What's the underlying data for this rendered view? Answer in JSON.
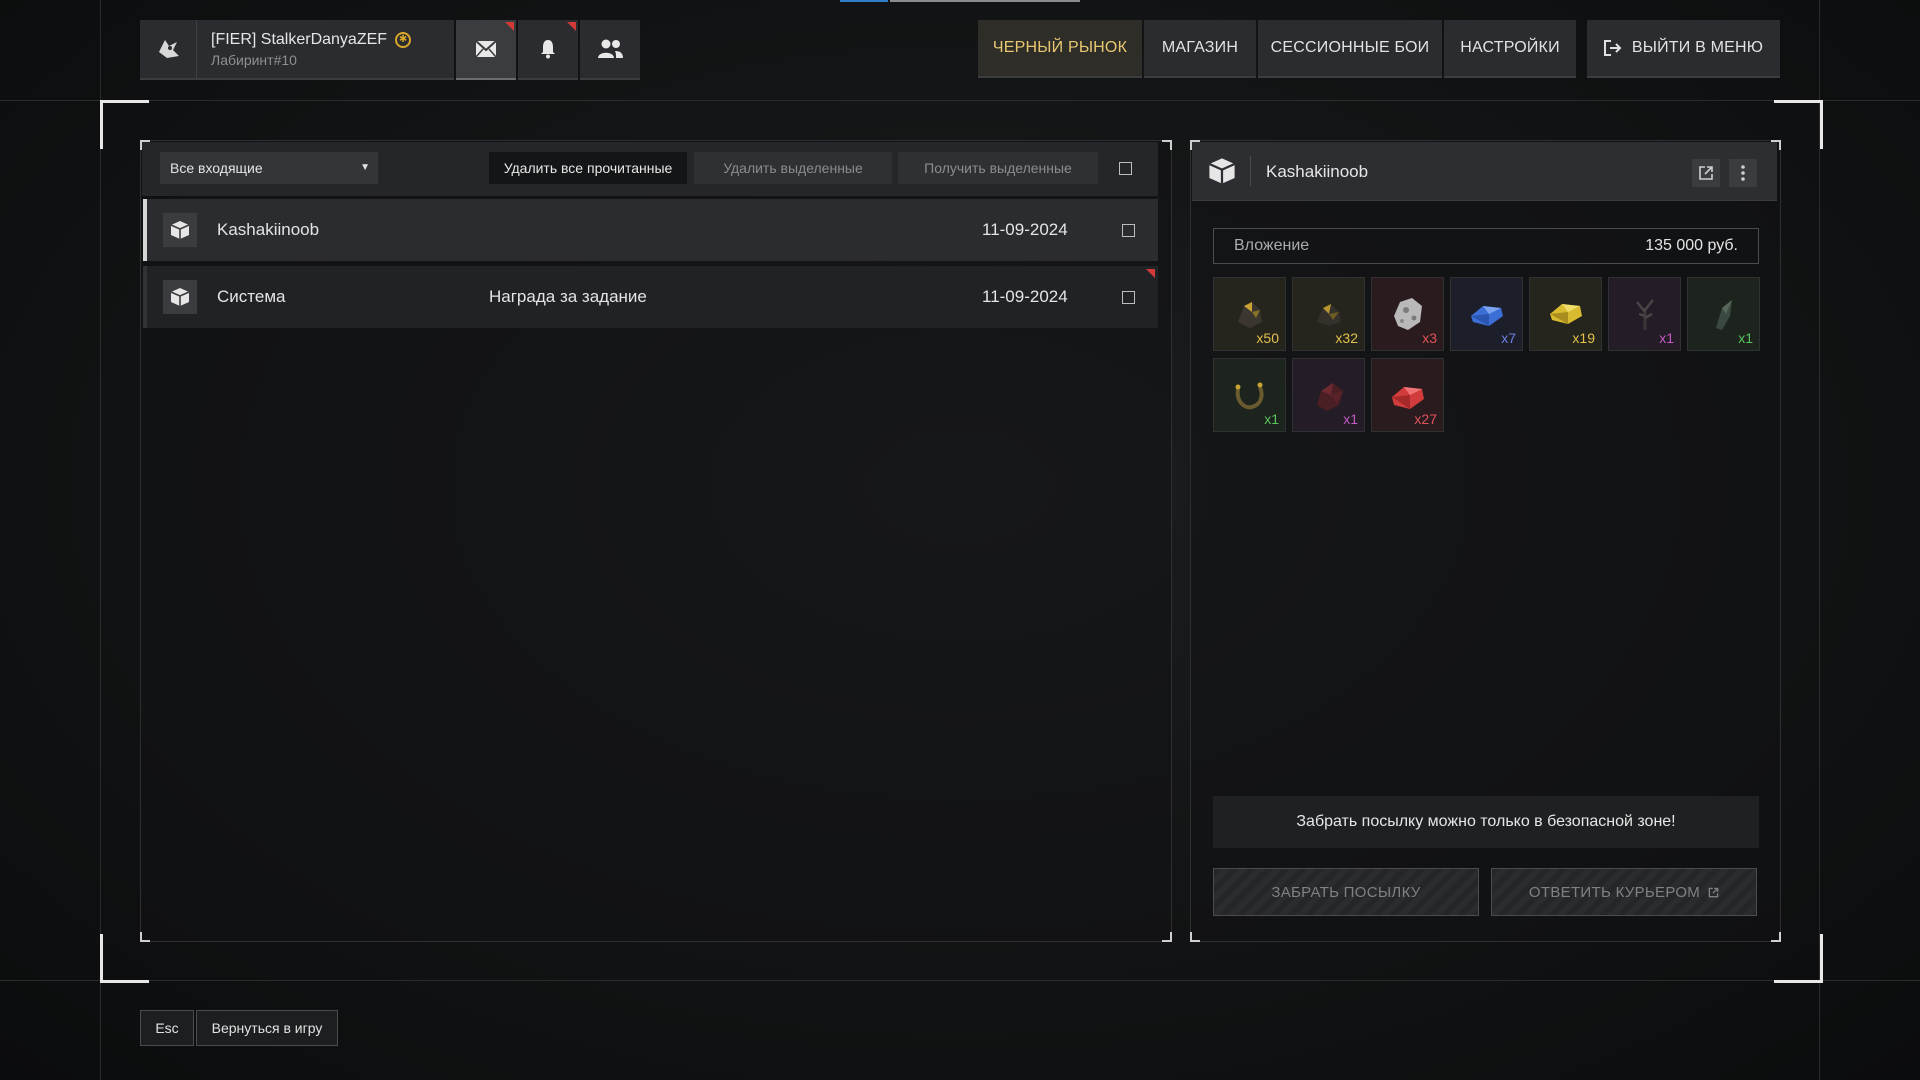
{
  "player": {
    "name": "[FIER] StalkerDanyaZEF",
    "location": "Лабиринт#10",
    "badge_icon": "sun-badge-icon"
  },
  "header_buttons": [
    {
      "name": "mail-icon",
      "active": true,
      "notify": true
    },
    {
      "name": "bell-icon",
      "active": false,
      "notify": true
    },
    {
      "name": "friends-icon",
      "active": false,
      "notify": false
    }
  ],
  "nav": {
    "black_market": "ЧЕРНЫЙ РЫНОК",
    "shop": "МАГАЗИН",
    "session_battles": "СЕССИОННЫЕ БОИ",
    "settings": "НАСТРОЙКИ",
    "exit": "ВЫЙТИ В МЕНЮ"
  },
  "mail": {
    "filter": "Все входящие",
    "delete_read": "Удалить все прочитанные",
    "delete_selected": "Удалить выделенные",
    "get_selected": "Получить выделенные",
    "messages": [
      {
        "sender": "Kashakiinoob",
        "subject": "",
        "date": "11-09-2024",
        "selected": true
      },
      {
        "sender": "Система",
        "subject": "Награда за задание",
        "date": "11-09-2024",
        "selected": false
      }
    ]
  },
  "detail": {
    "sender": "Kashakiinoob",
    "attachment_label": "Вложение",
    "attachment_value": "135 000 руб.",
    "items": [
      {
        "icon": "ore-dark-icon",
        "count": "x50",
        "color": "#e2c24a"
      },
      {
        "icon": "ore-dark-icon",
        "count": "x32",
        "color": "#e2c24a"
      },
      {
        "icon": "stone-white-icon",
        "count": "x3",
        "color": "#e0525a"
      },
      {
        "icon": "crystal-blue-icon",
        "count": "x7",
        "color": "#6f7fe0"
      },
      {
        "icon": "crystal-yellow-icon",
        "count": "x19",
        "color": "#e2c24a"
      },
      {
        "icon": "plant-dark-icon",
        "count": "x1",
        "color": "#c45ac4"
      },
      {
        "icon": "shard-green-icon",
        "count": "x1",
        "color": "#5ac45a"
      },
      {
        "icon": "ring-icon",
        "count": "x1",
        "color": "#5ac45a"
      },
      {
        "icon": "ore-red-icon",
        "count": "x1",
        "color": "#c45ac4"
      },
      {
        "icon": "crystal-red-icon",
        "count": "x27",
        "color": "#e0525a"
      }
    ],
    "warning": "Забрать посылку можно только в безопасной зоне!",
    "take_parcel": "ЗАБРАТЬ ПОСЫЛКУ",
    "reply_courier": "ОТВЕТИТЬ КУРЬЕРОМ"
  },
  "footer": {
    "esc": "Esc",
    "back": "Вернуться в игру"
  }
}
